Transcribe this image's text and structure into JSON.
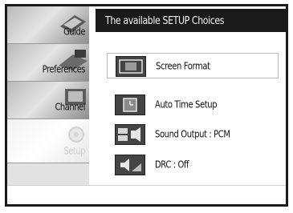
{
  "header": {
    "title": "The available SETUP Choices"
  },
  "menu": {
    "tabs": [
      {
        "label": "Guide",
        "icon": "guide-icon",
        "selected": false
      },
      {
        "label": "Preferences",
        "icon": "preferences-icon",
        "selected": false
      },
      {
        "label": "Channel",
        "icon": "channel-icon",
        "selected": false
      },
      {
        "label": "Setup",
        "icon": "setup-icon",
        "selected": true
      }
    ]
  },
  "setup": {
    "items": [
      {
        "label": "Screen Format",
        "icon": "screen-format-icon",
        "focused": true
      },
      {
        "label": "Auto Time Setup",
        "icon": "clock-icon",
        "focused": false
      },
      {
        "label": "Sound Output : PCM",
        "icon": "sound-output-icon",
        "focused": false
      },
      {
        "label": "DRC : Off",
        "icon": "drc-speaker-icon",
        "focused": false
      }
    ]
  }
}
